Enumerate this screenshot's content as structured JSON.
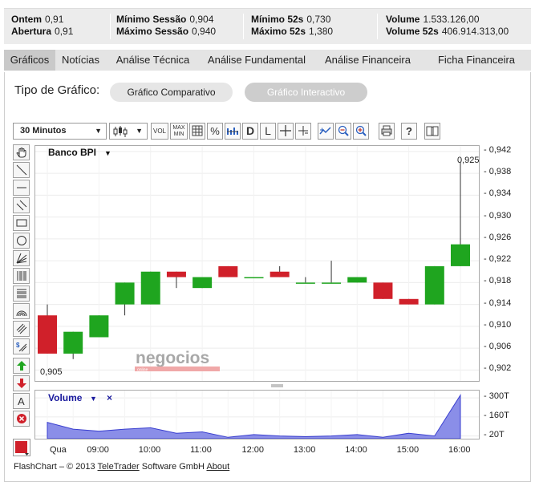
{
  "stats": {
    "col1": [
      {
        "label": "Ontem",
        "value": "0,91"
      },
      {
        "label": "Abertura",
        "value": "0,91"
      }
    ],
    "col2": [
      {
        "label": "Mínimo Sessão",
        "value": "0,904"
      },
      {
        "label": "Máximo Sessão",
        "value": "0,940"
      }
    ],
    "col3": [
      {
        "label": "Mínimo 52s",
        "value": "0,730"
      },
      {
        "label": "Máximo 52s",
        "value": "1,380"
      }
    ],
    "col4": [
      {
        "label": "Volume",
        "value": "1.533.126,00"
      },
      {
        "label": "Volume 52s",
        "value": "406.914.313,00"
      }
    ]
  },
  "tabs": [
    "Gráficos",
    "Notícias",
    "Análise Técnica",
    "Análise Fundamental",
    "Análise Financeira",
    "Ficha Financeira"
  ],
  "chart_type": {
    "label": "Tipo de Gráfico:",
    "options": [
      "Gráfico Comparativo",
      "Gráfico Interactivo"
    ]
  },
  "toolbar": {
    "interval": "30 Minutos",
    "vol_label": "VOL",
    "maxmin_label_top": "MAX",
    "maxmin_label_bottom": "MIN",
    "percent_label": "%",
    "d_label": "D",
    "l_label": "L",
    "help_label": "?"
  },
  "colors": {
    "up": "#1fa51f",
    "down": "#d0202a",
    "volume_fill": "#8a8ee8",
    "volume_line": "#3a3fcf",
    "title_blue": "#1a1a9e"
  },
  "chart_data": {
    "type": "candlestick",
    "title": "Banco BPI",
    "ylim": [
      0.9,
      0.943
    ],
    "yticks": [
      "0,902",
      "0,906",
      "0,910",
      "0,914",
      "0,918",
      "0,922",
      "0,926",
      "0,930",
      "0,934",
      "0,938",
      "0,942"
    ],
    "ytick_values": [
      0.902,
      0.906,
      0.91,
      0.914,
      0.918,
      0.922,
      0.926,
      0.93,
      0.934,
      0.938,
      0.942
    ],
    "xticks": [
      "Qua",
      "09:00",
      "10:00",
      "11:00",
      "12:00",
      "13:00",
      "14:00",
      "15:00",
      "16:00"
    ],
    "min_label": "0,905",
    "max_label": "0,925",
    "candles": [
      {
        "open": 0.912,
        "high": 0.914,
        "low": 0.905,
        "close": 0.905
      },
      {
        "open": 0.905,
        "high": 0.909,
        "low": 0.904,
        "close": 0.909
      },
      {
        "open": 0.908,
        "high": 0.912,
        "low": 0.908,
        "close": 0.912
      },
      {
        "open": 0.914,
        "high": 0.918,
        "low": 0.912,
        "close": 0.918
      },
      {
        "open": 0.914,
        "high": 0.92,
        "low": 0.914,
        "close": 0.92
      },
      {
        "open": 0.92,
        "high": 0.92,
        "low": 0.917,
        "close": 0.919
      },
      {
        "open": 0.917,
        "high": 0.919,
        "low": 0.917,
        "close": 0.919
      },
      {
        "open": 0.921,
        "high": 0.921,
        "low": 0.919,
        "close": 0.919
      },
      {
        "open": 0.919,
        "high": 0.919,
        "low": 0.919,
        "close": 0.919
      },
      {
        "open": 0.92,
        "high": 0.921,
        "low": 0.919,
        "close": 0.919
      },
      {
        "open": 0.918,
        "high": 0.919,
        "low": 0.918,
        "close": 0.918
      },
      {
        "open": 0.918,
        "high": 0.922,
        "low": 0.918,
        "close": 0.918
      },
      {
        "open": 0.918,
        "high": 0.919,
        "low": 0.918,
        "close": 0.919
      },
      {
        "open": 0.918,
        "high": 0.918,
        "low": 0.915,
        "close": 0.915
      },
      {
        "open": 0.915,
        "high": 0.915,
        "low": 0.914,
        "close": 0.914
      },
      {
        "open": 0.914,
        "high": 0.921,
        "low": 0.914,
        "close": 0.921
      },
      {
        "open": 0.921,
        "high": 0.94,
        "low": 0.921,
        "close": 0.925
      }
    ],
    "volume": {
      "title": "Volume",
      "yticks": [
        "20T",
        "160T",
        "300T"
      ],
      "ytick_values": [
        20,
        160,
        300
      ],
      "ylim": [
        0,
        330
      ],
      "values": [
        120,
        70,
        55,
        70,
        80,
        40,
        50,
        10,
        30,
        20,
        15,
        20,
        30,
        10,
        40,
        20,
        320
      ]
    }
  },
  "watermark": {
    "text": "negocios",
    "sub": "online"
  },
  "footer": {
    "prefix": "FlashChart – © 2013 ",
    "link1": "TeleTrader",
    "middle": " Software GmbH ",
    "link2": "About"
  }
}
